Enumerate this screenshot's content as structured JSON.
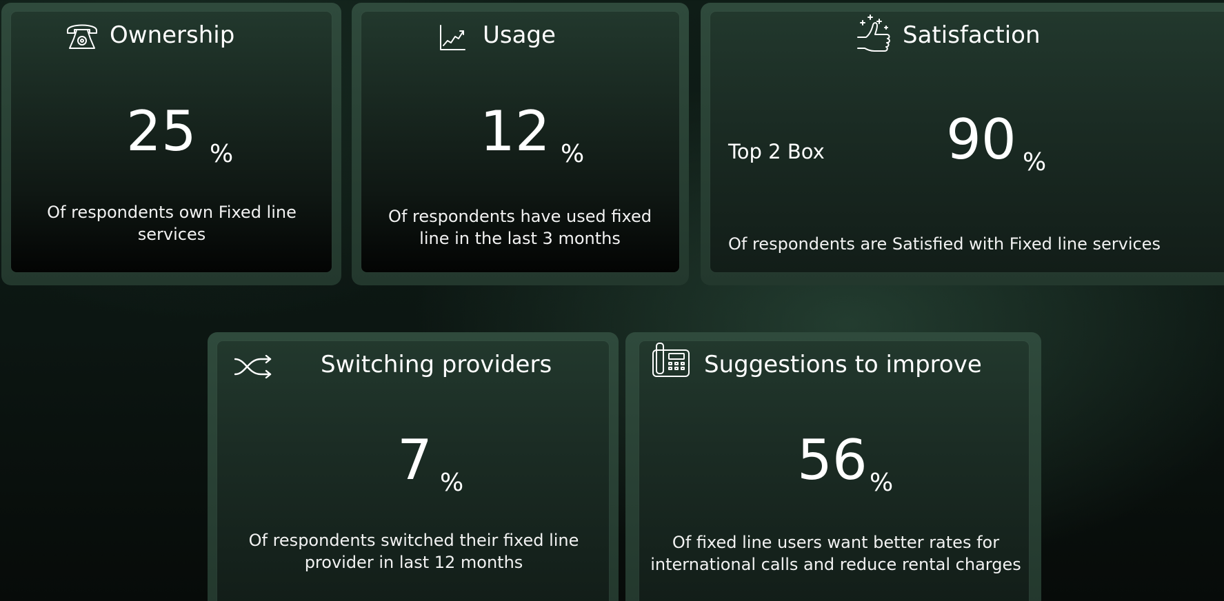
{
  "cards": {
    "ownership": {
      "title": "Ownership",
      "icon": "telephone-icon",
      "value": "25",
      "unit": "%",
      "description": "Of respondents own Fixed line services"
    },
    "usage": {
      "title": "Usage",
      "icon": "line-chart-icon",
      "value": "12",
      "unit": "%",
      "description": "Of respondents have used fixed line in the last 3 months"
    },
    "satisfaction": {
      "title": "Satisfaction",
      "icon": "thumbs-up-sparkle-icon",
      "label": "Top 2 Box",
      "value": "90",
      "unit": "%",
      "description": "Of respondents are Satisfied with Fixed line services"
    },
    "switching": {
      "title": "Switching providers",
      "icon": "shuffle-icon",
      "value": "7",
      "unit": "%",
      "description": "Of respondents switched their fixed line provider in last  12 months"
    },
    "suggestions": {
      "title": "Suggestions to improve",
      "icon": "desk-phone-icon",
      "value": "56",
      "unit": "%",
      "description": "Of fixed line users  want better rates for international calls and reduce rental charges"
    }
  },
  "colors": {
    "card_frame": "#2f4a3c",
    "card_inner_top": "#22382d",
    "text": "#ffffff"
  }
}
